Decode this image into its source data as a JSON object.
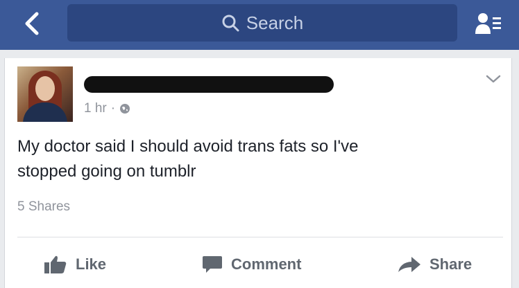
{
  "header": {
    "search_placeholder": "Search"
  },
  "post": {
    "timestamp": "1 hr",
    "separator": "·",
    "text_line1": "My doctor said I should avoid trans fats so I've",
    "text_line2": "stopped going on tumblr",
    "shares": "5 Shares"
  },
  "actions": {
    "like": "Like",
    "comment": "Comment",
    "share": "Share"
  },
  "icons": {
    "back": "chevron-left-icon",
    "search": "search-icon",
    "friends": "friend-requests-icon",
    "globe": "globe-icon",
    "menu": "chevron-down-icon",
    "like": "thumbs-up-icon",
    "comment": "comment-icon",
    "share": "share-arrow-icon"
  },
  "colors": {
    "brand": "#3b5998",
    "search_bg": "#2c4680",
    "meta_text": "#90949c",
    "action_text": "#606770"
  }
}
